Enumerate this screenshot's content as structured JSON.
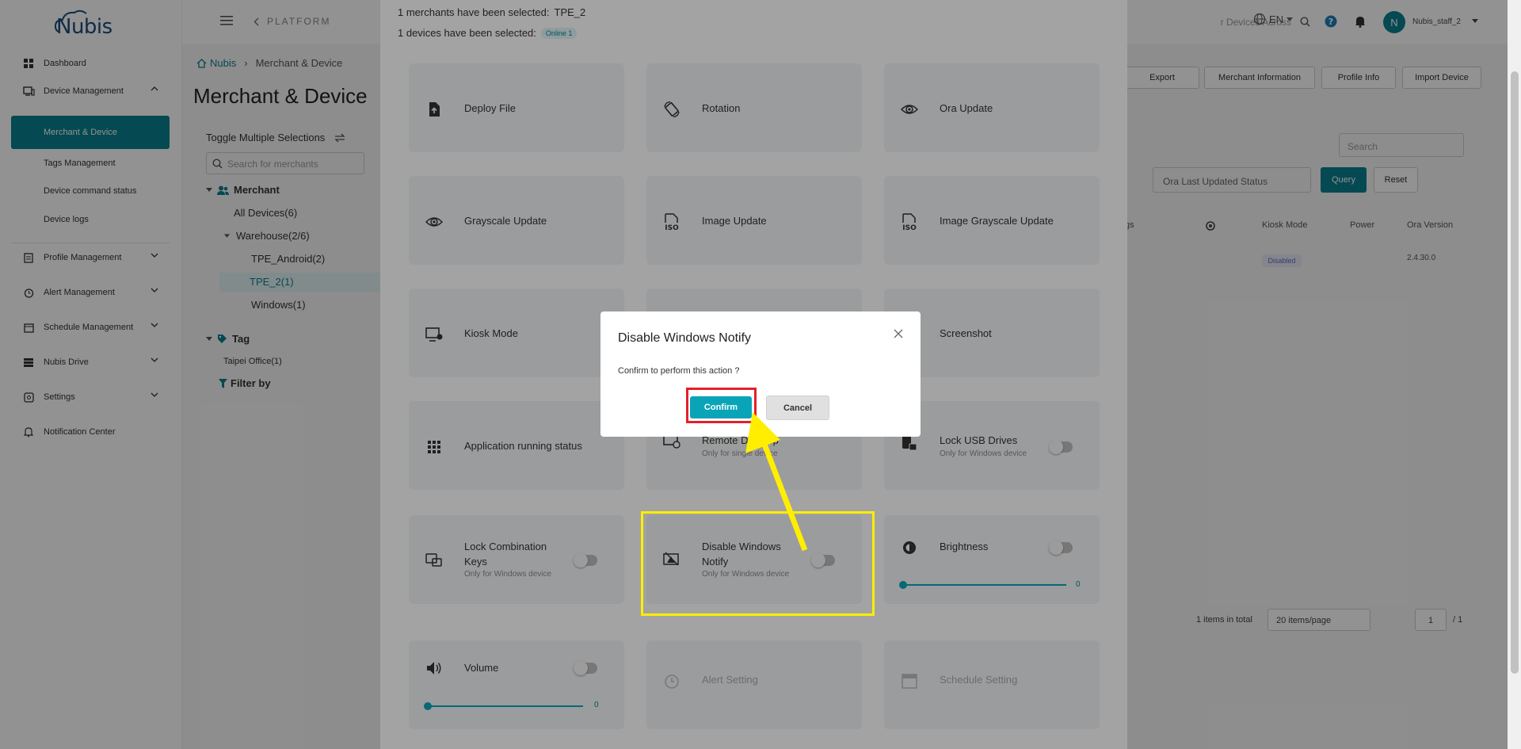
{
  "brand": {
    "logo_text": "Nubis"
  },
  "sidebar": {
    "dashboard": "Dashboard",
    "device_management": "Device Management",
    "merchant_device": "Merchant & Device",
    "tags_management": "Tags Management",
    "device_command_status": "Device command status",
    "device_logs": "Device logs",
    "profile_management": "Profile Management",
    "alert_management": "Alert Management",
    "schedule_management": "Schedule Management",
    "nubis_drive": "Nubis Drive",
    "settings": "Settings",
    "notification_center": "Notification Center"
  },
  "topbar": {
    "platform": "PLATFORM",
    "search_placeholder": "r Devices Across",
    "language": "EN",
    "avatar_letter": "N",
    "username": "Nubis_staff_2"
  },
  "main": {
    "breadcrumb": {
      "home": "Nubis",
      "current": "Merchant & Device"
    },
    "page_title": "Merchant & Device",
    "toggle_multiple": "Toggle Multiple Selections",
    "merchant_search_placeholder": "Search for merchants",
    "tree": {
      "merchant": "Merchant",
      "all_devices": "All Devices(6)",
      "warehouse": "Warehouse(2/6)",
      "tpe_android": "TPE_Android(2)",
      "tpe_2": "TPE_2(1)",
      "windows": "Windows(1)",
      "tag": "Tag",
      "taipei_office": "Taipei Office(1)",
      "filter_by": "Filter by"
    },
    "actions": {
      "export": "Export",
      "merchant_info": "Merchant Information",
      "profile_info": "Profile Info",
      "import_device": "Import Device"
    },
    "table_search_placeholder": "Search",
    "ora_status_placeholder": "Ora Last Updated Status",
    "query": "Query",
    "reset": "Reset",
    "columns": {
      "tags": "gs",
      "kiosk_mode": "Kiosk Mode",
      "power": "Power",
      "ora_version": "Ora Version"
    },
    "row": {
      "kiosk_mode": "Disabled",
      "ora_version": "2.4.30.0"
    },
    "pager": {
      "total": "1 items in total",
      "per_page": "20 items/page",
      "page": "1",
      "of": "/ 1"
    }
  },
  "panel": {
    "merchants_selected_label": "1 merchants have been selected:",
    "merchants_selected_value": "TPE_2",
    "devices_selected_label": "1 devices have been selected:",
    "online_badge": "Online 1",
    "cards": {
      "deploy_file": "Deploy File",
      "rotation": "Rotation",
      "ora_update": "Ora Update",
      "grayscale_update": "Grayscale Update",
      "image_update": "Image Update",
      "image_grayscale_update": "Image Grayscale Update",
      "kiosk_mode": "Kiosk Mode",
      "screenshot": "Screenshot",
      "app_running_status": "Application running status",
      "remote_desktop": "Remote Desktop",
      "remote_desktop_sub": "Only for single device",
      "lock_usb": "Lock USB Drives",
      "lock_usb_sub": "Only for Windows device",
      "lock_combo": "Lock Combination Keys",
      "lock_combo_sub": "Only for Windows device",
      "disable_notify": "Disable Windows Notify",
      "disable_notify_sub": "Only for Windows device",
      "brightness": "Brightness",
      "brightness_value": "0",
      "volume": "Volume",
      "volume_value": "0",
      "alert_setting": "Alert Setting",
      "schedule_setting": "Schedule Setting"
    }
  },
  "modal": {
    "title": "Disable Windows Notify",
    "body": "Confirm to perform this action ?",
    "confirm": "Confirm",
    "cancel": "Cancel"
  },
  "colors": {
    "accent": "#0a7f8f",
    "confirm": "#0aa4b8",
    "highlight_red": "#e4202a",
    "highlight_yellow": "#ffee00"
  }
}
